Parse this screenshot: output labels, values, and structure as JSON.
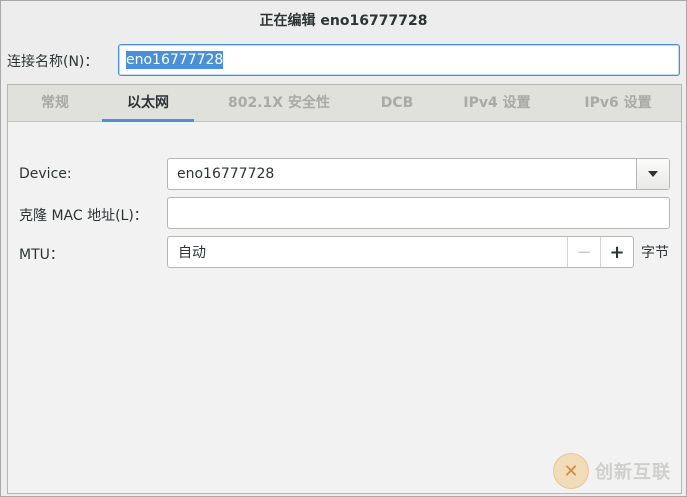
{
  "window": {
    "title": "正在编辑 eno16777728"
  },
  "connection_name": {
    "label": "连接名称(N)：",
    "value": "eno16777728"
  },
  "tabs": [
    {
      "label": "常规",
      "active": false
    },
    {
      "label": "以太网",
      "active": true
    },
    {
      "label": "802.1X 安全性",
      "active": false
    },
    {
      "label": "DCB",
      "active": false
    },
    {
      "label": "IPv4 设置",
      "active": false
    },
    {
      "label": "IPv6 设置",
      "active": false
    }
  ],
  "ethernet": {
    "device_label": "Device:",
    "device_value": "eno16777728",
    "mac_label": "克隆 MAC 地址(L)：",
    "mac_value": "",
    "mtu_label": "MTU：",
    "mtu_value": "自动",
    "mtu_unit": "字节",
    "minus_symbol": "−",
    "plus_symbol": "+"
  },
  "watermark": {
    "text": "创新互联",
    "logo_glyph": "✕"
  },
  "colors": {
    "accent": "#4a90d9",
    "tab_inactive": "#a8aaa7"
  }
}
